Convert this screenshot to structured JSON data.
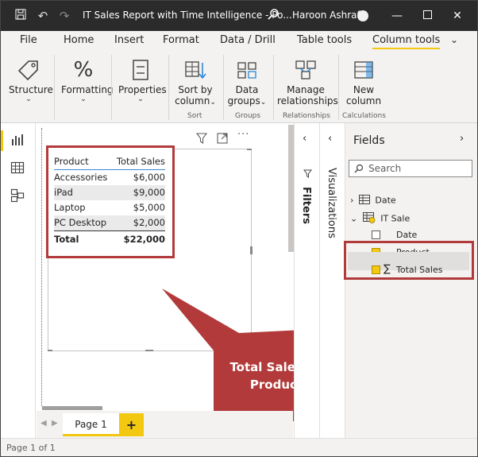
{
  "window": {
    "title": "IT Sales Report with Time Intelligence - Po...",
    "user": "Haroon Ashraf"
  },
  "tabs": [
    {
      "label": "File",
      "active": false
    },
    {
      "label": "Home",
      "active": false
    },
    {
      "label": "Insert",
      "active": false
    },
    {
      "label": "Format",
      "active": false
    },
    {
      "label": "Data / Drill",
      "active": false
    },
    {
      "label": "Table tools",
      "active": false
    },
    {
      "label": "Column tools",
      "active": true
    }
  ],
  "ribbon": {
    "structure": "Structure",
    "formatting": "Formatting",
    "properties": "Properties",
    "sort_by_1": "Sort by",
    "sort_by_2": "column",
    "data_groups_1": "Data",
    "data_groups_2": "groups",
    "manage_rel_1": "Manage",
    "manage_rel_2": "relationships",
    "new_column_1": "New",
    "new_column_2": "column",
    "group_sort": "Sort",
    "group_groups": "Groups",
    "group_relationships": "Relationships",
    "group_calculations": "Calculations"
  },
  "table_visual": {
    "headers": [
      "Product",
      "Total Sales"
    ],
    "rows": [
      [
        "Accessories",
        "$6,000"
      ],
      [
        "iPad",
        "$9,000"
      ],
      [
        "Laptop",
        "$5,000"
      ],
      [
        "PC Desktop",
        "$2,000"
      ]
    ],
    "total": [
      "Total",
      "$22,000"
    ]
  },
  "callout": {
    "line1": "Total Sales by",
    "line2": "Product"
  },
  "pages": {
    "tab": "Page 1",
    "add": "+",
    "status": "Page 1 of 1"
  },
  "panes": {
    "filters": "Filters",
    "visualizations": "Visualizations"
  },
  "fields": {
    "title": "Fields",
    "search_placeholder": "Search",
    "tables": [
      {
        "name": "Date",
        "expanded": false
      },
      {
        "name": "IT Sale",
        "expanded": true
      }
    ],
    "columns": [
      {
        "name": "Date",
        "checked": false
      },
      {
        "name": "Product",
        "checked": true
      },
      {
        "name": "Total Sales",
        "checked": true
      }
    ]
  },
  "colors": {
    "accent": "#f2c811",
    "highlight_border": "#b23a3a",
    "titlebar": "#2b2b2b"
  }
}
